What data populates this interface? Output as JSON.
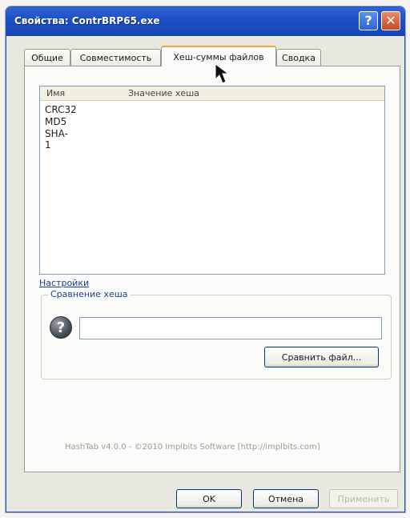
{
  "window": {
    "title": "Свойства: ContrBRP65.exe",
    "help_glyph": "?",
    "close_glyph": "✕"
  },
  "tabs": [
    {
      "label": "Общие"
    },
    {
      "label": "Совместимость"
    },
    {
      "label": "Хеш-суммы файлов",
      "active": true
    },
    {
      "label": "Сводка"
    }
  ],
  "hash_list": {
    "columns": [
      "Имя",
      "Значение хеша"
    ],
    "rows": [
      "CRC32",
      "MD5",
      "SHA-1"
    ]
  },
  "settings_link": "Настройки",
  "hash_compare": {
    "group_label": "Сравнение хеша",
    "input_value": "",
    "help_glyph": "?",
    "compare_button": "Сравнить файл..."
  },
  "credit": "HashTab v4.0.0 - ©2010 Implbits Software [http://implbits.com]",
  "buttons": {
    "ok": "OK",
    "cancel": "Отмена",
    "apply": "Применить"
  },
  "colors": {
    "titlebar": "#1c4fc4",
    "active_tab_accent": "#f1a63c",
    "link": "#1b3ea0"
  }
}
